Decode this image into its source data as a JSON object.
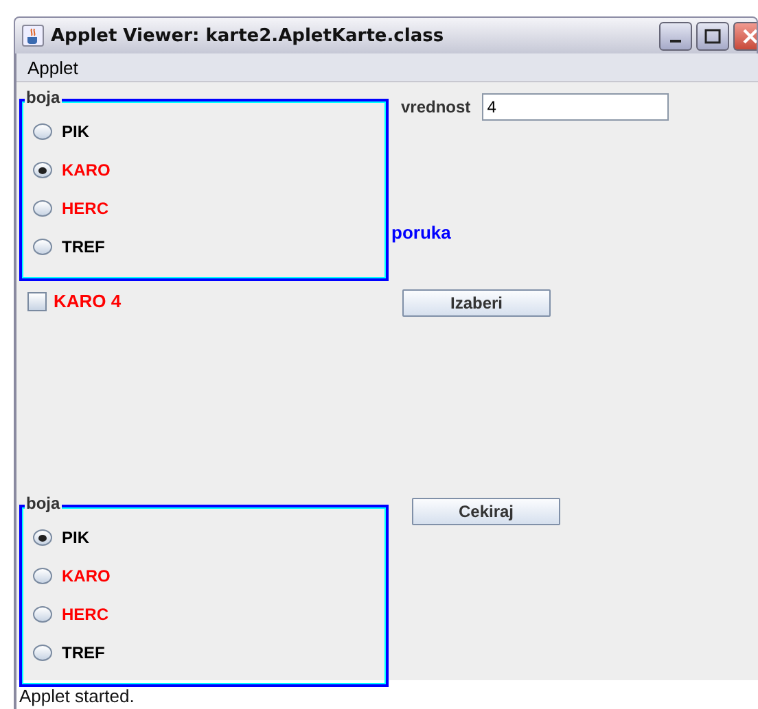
{
  "window": {
    "title": "Applet Viewer: karte2.ApletKarte.class"
  },
  "menu": [
    "Applet"
  ],
  "group_top": {
    "title": "boja",
    "options": [
      {
        "label": "PIK",
        "selected": false,
        "color": "#000000"
      },
      {
        "label": "KARO",
        "selected": true,
        "color": "#ff0000"
      },
      {
        "label": "HERC",
        "selected": false,
        "color": "#ff0000"
      },
      {
        "label": "TREF",
        "selected": false,
        "color": "#000000"
      }
    ]
  },
  "value_field": {
    "label": "vrednost",
    "value": "4"
  },
  "message": "poruka",
  "checkbox": {
    "label": "KARO 4",
    "checked": false
  },
  "choose_button": "Izaberi",
  "check_button": "Cekiraj",
  "group_bottom": {
    "title": "boja",
    "options": [
      {
        "label": "PIK",
        "selected": true,
        "color": "#000000"
      },
      {
        "label": "KARO",
        "selected": false,
        "color": "#ff0000"
      },
      {
        "label": "HERC",
        "selected": false,
        "color": "#ff0000"
      },
      {
        "label": "TREF",
        "selected": false,
        "color": "#000000"
      }
    ]
  },
  "status_bar": "Applet started."
}
